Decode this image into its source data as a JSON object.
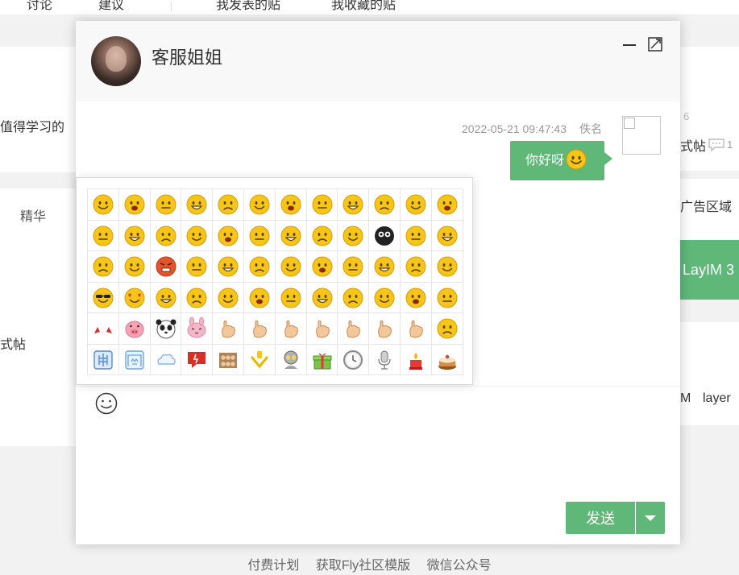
{
  "background": {
    "nav": [
      "讨论",
      "建议",
      "我发表的贴",
      "我收藏的贴"
    ],
    "left_snippets": [
      "值得学习的",
      "精华",
      "式帖"
    ],
    "right_snippets": [
      "6",
      "式帖",
      "1",
      "广告区域",
      "LayIM 3",
      "M",
      "layer"
    ],
    "footer_links": [
      "付费计划",
      "获取Fly社区模版",
      "微信公众号"
    ]
  },
  "chat": {
    "title": "客服姐姐",
    "message": {
      "time": "2022-05-21 09:47:43",
      "author": "佚名",
      "text": "你好呀"
    },
    "send_label": "发送"
  },
  "face_panel": {
    "rows": [
      [
        "微笑",
        "嘻嘻",
        "哈哈",
        "可爱",
        "可怜",
        "挖鼻",
        "吃惊",
        "害羞",
        "挤眼",
        "闭嘴",
        "鄙视",
        "爱你"
      ],
      [
        "泪",
        "偷笑",
        "亲亲",
        "生病",
        "太开心",
        "白眼",
        "右哼哼",
        "左哼哼",
        "嘘",
        "衰",
        "委屈",
        "吐"
      ],
      [
        "哈欠",
        "抱抱",
        "怒",
        "疑问",
        "馋嘴",
        "拜拜",
        "思考",
        "汗",
        "困",
        "睡",
        "钱",
        "失望"
      ],
      [
        "酷",
        "色",
        "哼",
        "鼓掌",
        "晕",
        "悲伤",
        "抓狂",
        "黑线",
        "阴险",
        "怒骂",
        "互粉",
        "心"
      ],
      [
        "伤心",
        "猪头",
        "熊猫",
        "兔子",
        "ok",
        "耶",
        "good",
        "NO",
        "赞",
        "来",
        "弱",
        "草泥马"
      ],
      [
        "神马",
        "囧",
        "浮云",
        "给力",
        "围观",
        "威武",
        "奥特曼",
        "礼物",
        "钟",
        "话筒",
        "蜡烛",
        "蛋糕"
      ]
    ]
  },
  "colors": {
    "accent": "#5fb878",
    "emoji_yellow": "#f5c518",
    "page_bg": "#f2f2f2"
  }
}
